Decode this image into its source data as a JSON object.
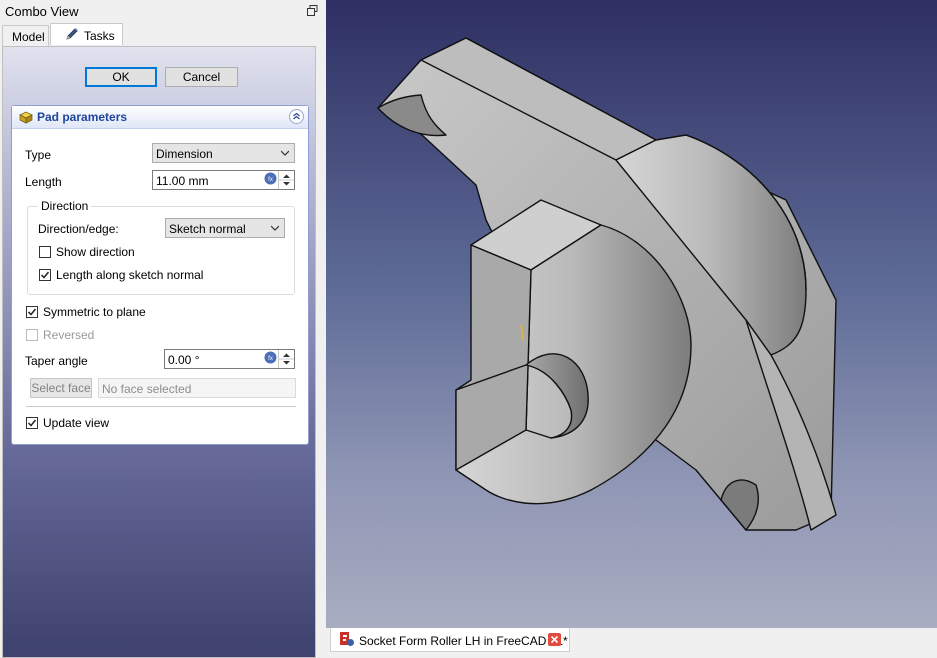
{
  "panel": {
    "title": "Combo View",
    "tabs": [
      {
        "label": "Model"
      },
      {
        "label": "Tasks",
        "icon": "pencil-icon"
      }
    ]
  },
  "buttons": {
    "ok": "OK",
    "cancel": "Cancel"
  },
  "pad": {
    "title": "Pad parameters",
    "type_label": "Type",
    "type_value": "Dimension",
    "length_label": "Length",
    "length_value": "11.00 mm",
    "direction": {
      "group_title": "Direction",
      "edge_label": "Direction/edge:",
      "edge_value": "Sketch normal",
      "show_direction_label": "Show direction",
      "show_direction_checked": false,
      "length_along_label": "Length along sketch normal",
      "length_along_checked": true
    },
    "symmetric_label": "Symmetric to plane",
    "symmetric_checked": true,
    "reversed_label": "Reversed",
    "reversed_checked": false,
    "taper_label": "Taper angle",
    "taper_value": "0.00 °",
    "select_face_label": "Select face",
    "face_field_value": "No face selected",
    "update_view_label": "Update view",
    "update_view_checked": true
  },
  "document": {
    "tab_title": "Socket Form Roller LH in FreeCAD : 1*"
  },
  "colors": {
    "accent": "#0078d7",
    "header_text": "#21459f",
    "model_face": "#b5b5b5",
    "viewport_top": "#2e2f62",
    "viewport_bottom": "#a9adc1"
  }
}
